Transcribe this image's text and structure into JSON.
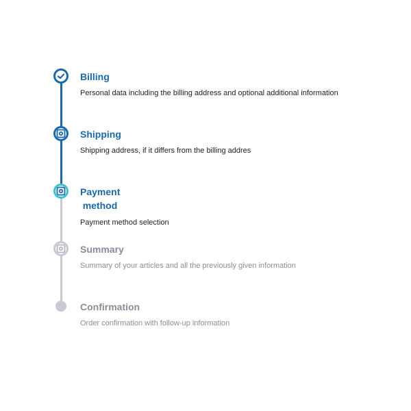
{
  "colors": {
    "complete": "#1a69ad",
    "current": "#3cc3cf",
    "pending": "#c9c9d3"
  },
  "steps": [
    {
      "title": "Billing",
      "description": "Personal data including the billing address and optional additional information",
      "state": "complete",
      "icon": "check-icon"
    },
    {
      "title": "Shipping",
      "description": "Shipping address, if it differs from the billing addres",
      "state": "complete",
      "icon": "frame-icon"
    },
    {
      "title": "Payment method",
      "description": "Payment method selection",
      "state": "current",
      "icon": "frame-icon"
    },
    {
      "title": "Summary",
      "description": "Summary of your articles and all the previously given information",
      "state": "pending",
      "icon": "frame-icon"
    },
    {
      "title": "Confirmation",
      "description": "Order confirmation with follow-up information",
      "state": "pending",
      "icon": "dot-icon"
    }
  ]
}
